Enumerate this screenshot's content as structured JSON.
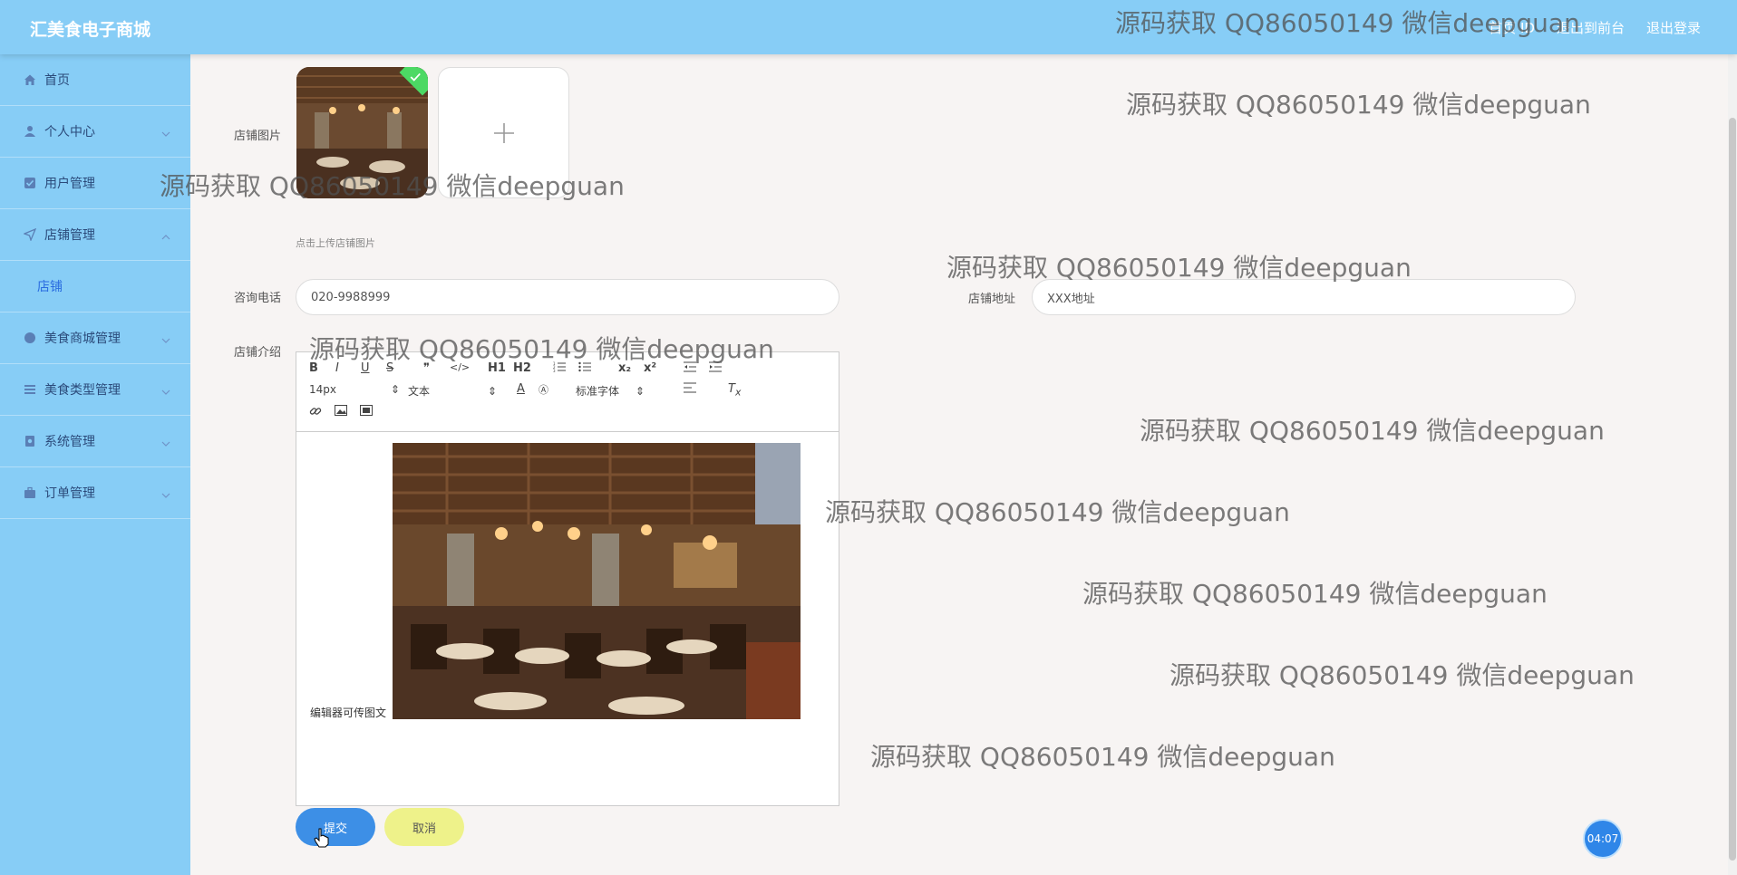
{
  "header": {
    "brand": "汇美食电子商城",
    "links": [
      "首页 ID",
      "退出到前台",
      "退出登录"
    ]
  },
  "sidebar": {
    "items": [
      {
        "label": "首页",
        "icon": "home-icon"
      },
      {
        "label": "个人中心",
        "icon": "user-icon"
      },
      {
        "label": "用户管理",
        "icon": "check-square-icon"
      },
      {
        "label": "店铺管理",
        "icon": "send-icon",
        "expanded": true
      },
      {
        "label": "美食商城管理",
        "icon": "circle-icon"
      },
      {
        "label": "美食类型管理",
        "icon": "list-icon"
      },
      {
        "label": "系统管理",
        "icon": "gear-icon"
      },
      {
        "label": "订单管理",
        "icon": "briefcase-icon"
      }
    ],
    "submenu": [
      "店铺"
    ]
  },
  "form": {
    "shop_image_label": "店铺图片",
    "upload_hint": "点击上传店铺图片",
    "phone_label": "咨询电话",
    "phone_value": "020-9988999",
    "address_label": "店铺地址",
    "address_value": "XXX地址",
    "intro_label": "店铺介绍",
    "editor": {
      "font_size": "14px",
      "block_type": "文本",
      "font_family": "标准字体",
      "content_text": "编辑器可传图文",
      "toolbar": [
        "B",
        "I",
        "U",
        "S",
        "❞",
        "</>",
        "H1",
        "H2",
        "ol",
        "ul",
        "x₂",
        "x²",
        "outdent",
        "indent",
        "A",
        "bg",
        "align",
        "Tx",
        "link",
        "image",
        "video"
      ]
    },
    "submit_label": "提交",
    "cancel_label": "取消"
  },
  "timer": "04:07",
  "watermark": "源码获取 QQ86050149 微信deepguan",
  "colors": {
    "header_bg": "#87cdf6",
    "sidebar_bg": "#87cdf6",
    "active_sub": "#2a6ce0",
    "submit_bg": "#3d8fe6",
    "cancel_bg": "#eef28a"
  }
}
